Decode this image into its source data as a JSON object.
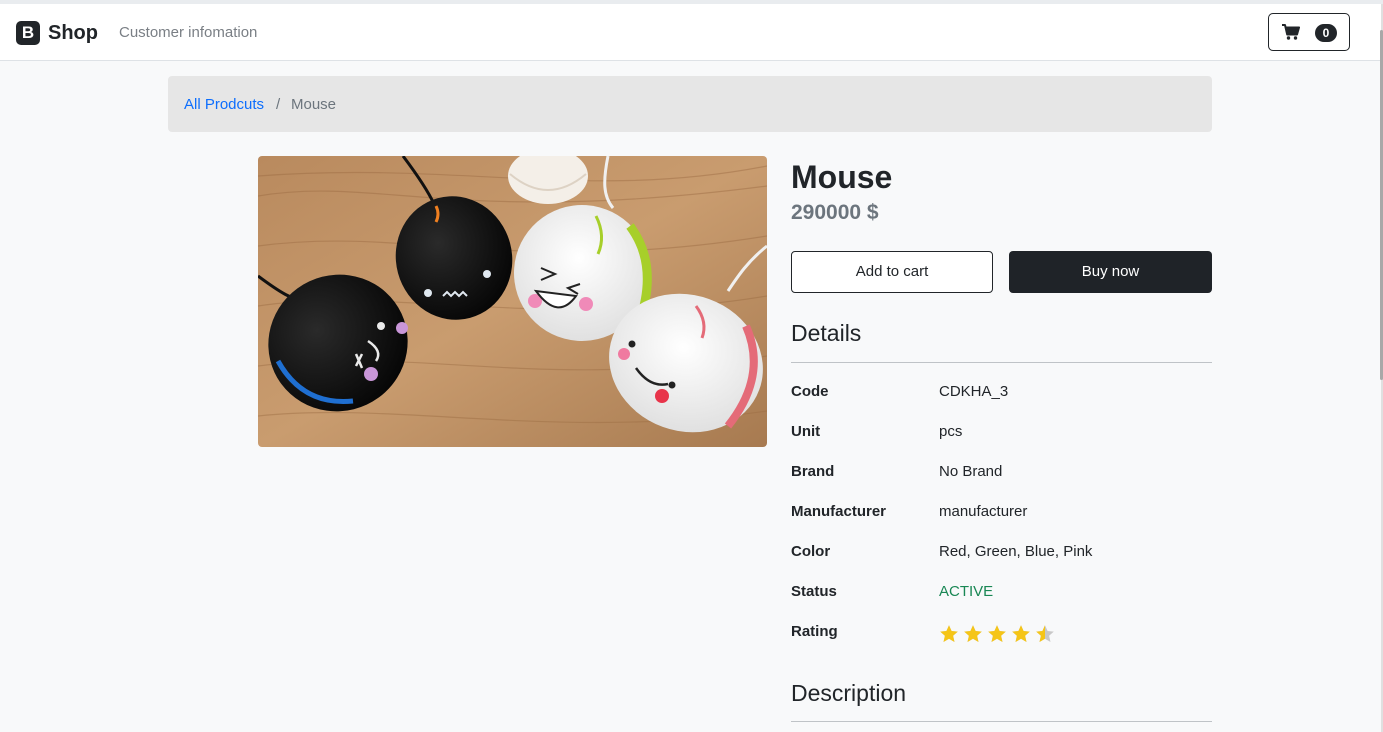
{
  "navbar": {
    "brand_logo": "B",
    "brand_name": "Shop",
    "link_customer": "Customer infomation",
    "cart_count": "0"
  },
  "breadcrumb": {
    "root": "All Prodcuts",
    "separator": "/",
    "current": "Mouse"
  },
  "product": {
    "title": "Mouse",
    "price": "290000 $",
    "image_desc": "mouse-product-photo"
  },
  "actions": {
    "add_to_cart": "Add to cart",
    "buy_now": "Buy now"
  },
  "details": {
    "heading": "Details",
    "rows": [
      {
        "label": "Code",
        "value": "CDKHA_3"
      },
      {
        "label": "Unit",
        "value": "pcs"
      },
      {
        "label": "Brand",
        "value": "No Brand"
      },
      {
        "label": "Manufacturer",
        "value": "manufacturer"
      },
      {
        "label": "Color",
        "value": "Red, Green, Blue, Pink"
      },
      {
        "label": "Status",
        "value": "ACTIVE"
      },
      {
        "label": "Rating",
        "value": ""
      }
    ],
    "rating": 4.5,
    "rating_max": 5
  },
  "description": {
    "heading": "Description"
  },
  "colors": {
    "link": "#0d6efd",
    "status_active": "#198754",
    "star_filled": "#f5c518",
    "star_empty": "#c8c8c8",
    "dark": "#212529"
  }
}
